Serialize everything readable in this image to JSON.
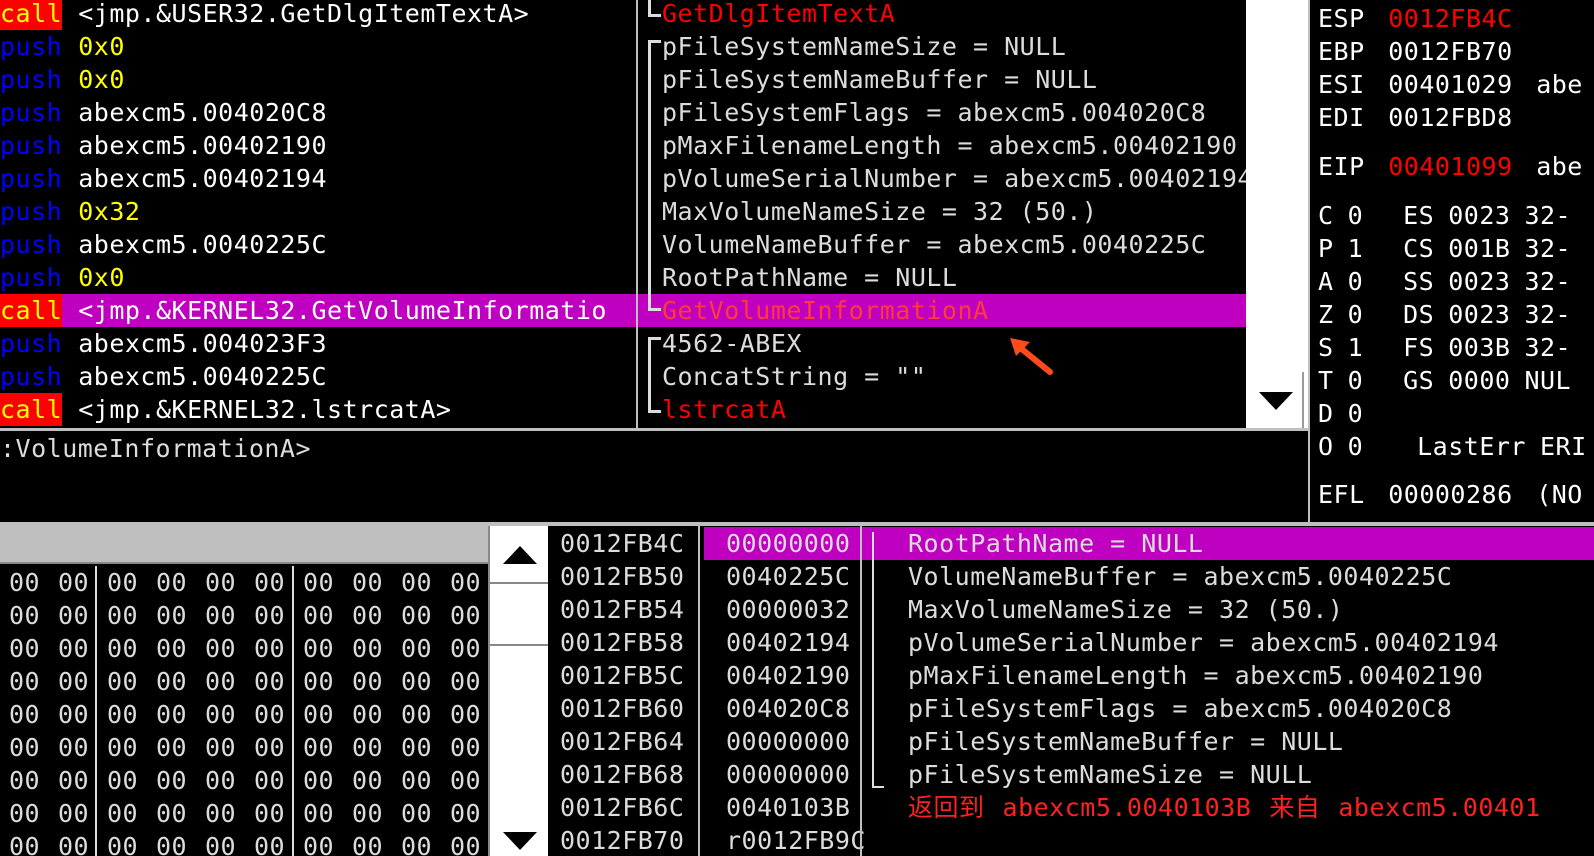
{
  "disasm": {
    "rows": [
      {
        "mnem": "call",
        "operand": "<jmp.&USER32.GetDlgItemTextA>",
        "kind": "call"
      },
      {
        "mnem": "push",
        "operand": "0x0",
        "kind": "imm"
      },
      {
        "mnem": "push",
        "operand": "0x0",
        "kind": "imm"
      },
      {
        "mnem": "push",
        "operand": "abexcm5.004020C8",
        "kind": "addr"
      },
      {
        "mnem": "push",
        "operand": "abexcm5.00402190",
        "kind": "addr"
      },
      {
        "mnem": "push",
        "operand": "abexcm5.00402194",
        "kind": "addr"
      },
      {
        "mnem": "push",
        "operand": "0x32",
        "kind": "imm"
      },
      {
        "mnem": "push",
        "operand": "abexcm5.0040225C",
        "kind": "addr"
      },
      {
        "mnem": "push",
        "operand": "0x0",
        "kind": "imm"
      },
      {
        "mnem": "call",
        "operand": "<jmp.&KERNEL32.GetVolumeInformatio",
        "kind": "call"
      },
      {
        "mnem": "push",
        "operand": "abexcm5.004023F3",
        "kind": "addr"
      },
      {
        "mnem": "push",
        "operand": "abexcm5.0040225C",
        "kind": "addr"
      },
      {
        "mnem": "call",
        "operand": "<jmp.&KERNEL32.lstrcatA>",
        "kind": "call"
      }
    ],
    "info_line": ":VolumeInformationA>"
  },
  "comments": {
    "rows": [
      "GetDlgItemTextA",
      "pFileSystemNameSize = NULL",
      "pFileSystemNameBuffer = NULL",
      "pFileSystemFlags = abexcm5.004020C8",
      "pMaxFilenameLength = abexcm5.00402190",
      "pVolumeSerialNumber = abexcm5.00402194",
      "MaxVolumeNameSize = 32 (50.)",
      "VolumeNameBuffer = abexcm5.0040225C",
      "RootPathName = NULL",
      "GetVolumeInformationA",
      "4562-ABEX",
      "ConcatString = \"\"",
      "lstrcatA"
    ]
  },
  "registers": {
    "esp": {
      "name": "ESP",
      "value": "0012FB4C"
    },
    "ebp": {
      "name": "EBP",
      "value": "0012FB70"
    },
    "esi": {
      "name": "ESI",
      "value": "00401029",
      "extra": "abe"
    },
    "edi": {
      "name": "EDI",
      "value": "0012FBD8"
    },
    "eip": {
      "name": "EIP",
      "value": "00401099",
      "extra": "abe"
    },
    "flags": [
      {
        "f": "C",
        "v": "0",
        "seg": "ES",
        "sv": "0023",
        "bits": "32-"
      },
      {
        "f": "P",
        "v": "1",
        "seg": "CS",
        "sv": "001B",
        "bits": "32-"
      },
      {
        "f": "A",
        "v": "0",
        "seg": "SS",
        "sv": "0023",
        "bits": "32-"
      },
      {
        "f": "Z",
        "v": "0",
        "seg": "DS",
        "sv": "0023",
        "bits": "32-"
      },
      {
        "f": "S",
        "v": "1",
        "seg": "FS",
        "sv": "003B",
        "bits": "32-"
      },
      {
        "f": "T",
        "v": "0",
        "seg": "GS",
        "sv": "0000",
        "bits": "NUL"
      },
      {
        "f": "D",
        "v": "0",
        "seg": "",
        "sv": "",
        "bits": ""
      },
      {
        "f": "O",
        "v": "0",
        "seg": "",
        "sv": "LastErr",
        "bits": "ERI"
      }
    ],
    "efl": {
      "name": "EFL",
      "value": "00000286",
      "extra": "(NO"
    }
  },
  "dump": {
    "byte": "00",
    "rows": 9
  },
  "stack": {
    "rows": [
      {
        "addr": "0012FB4C",
        "val": "00000000",
        "comment": "RootPathName = NULL"
      },
      {
        "addr": "0012FB50",
        "val": "0040225C",
        "comment": "VolumeNameBuffer = abexcm5.0040225C"
      },
      {
        "addr": "0012FB54",
        "val": "00000032",
        "comment": "MaxVolumeNameSize = 32 (50.)"
      },
      {
        "addr": "0012FB58",
        "val": "00402194",
        "comment": "pVolumeSerialNumber = abexcm5.00402194"
      },
      {
        "addr": "0012FB5C",
        "val": "00402190",
        "comment": "pMaxFilenameLength = abexcm5.00402190"
      },
      {
        "addr": "0012FB60",
        "val": "004020C8",
        "comment": "pFileSystemFlags = abexcm5.004020C8"
      },
      {
        "addr": "0012FB64",
        "val": "00000000",
        "comment": "pFileSystemNameBuffer = NULL"
      },
      {
        "addr": "0012FB68",
        "val": "00000000",
        "comment": "pFileSystemNameSize = NULL"
      },
      {
        "addr": "0012FB6C",
        "val": "0040103B",
        "comment_cn1": "返回到",
        "comment_a": "abexcm5.0040103B",
        "comment_cn2": "来自",
        "comment_b": "abexcm5.00401"
      },
      {
        "addr": "0012FB70",
        "val": "r0012FB9C",
        "comment": ""
      }
    ]
  }
}
